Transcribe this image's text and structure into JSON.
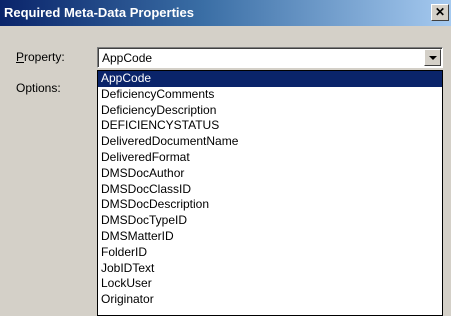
{
  "window": {
    "title": "Required Meta-Data Properties",
    "close_glyph": "✕"
  },
  "form": {
    "property_label_accel": "P",
    "property_label_rest": "roperty:",
    "options_label": "Options:"
  },
  "property_select": {
    "value": "AppCode",
    "options": [
      "AppCode",
      "DeficiencyComments",
      "DeficiencyDescription",
      "DEFICIENCYSTATUS",
      "DeliveredDocumentName",
      "DeliveredFormat",
      "DMSDocAuthor",
      "DMSDocClassID",
      "DMSDocDescription",
      "DMSDocTypeID",
      "DMSMatterID",
      "FolderID",
      "JobIDText",
      "LockUser",
      "Originator"
    ],
    "selected_index": 0
  },
  "colors": {
    "titlebar_start": "#0a246a",
    "titlebar_end": "#a6caf0",
    "selection": "#0a246a",
    "dialog_bg": "#d4d0c8"
  }
}
